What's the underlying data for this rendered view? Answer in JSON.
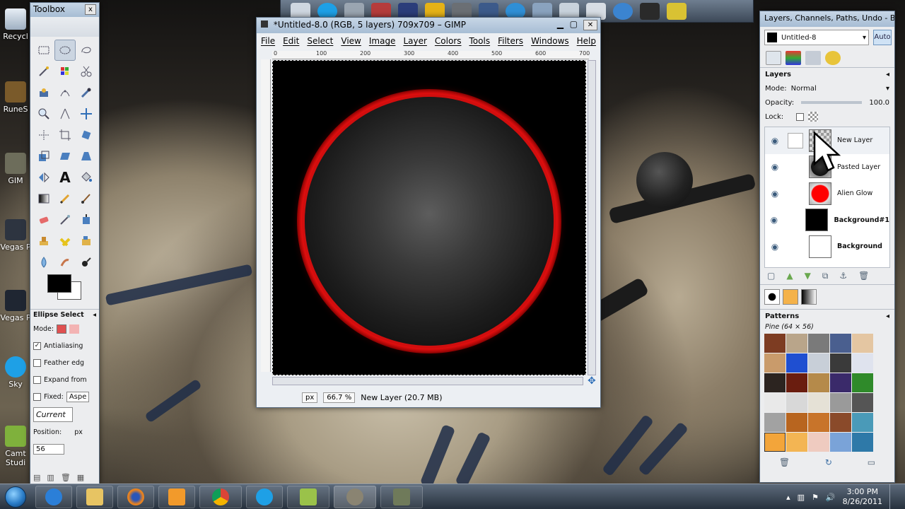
{
  "desktop": {
    "icons": [
      {
        "label": "Recycl"
      },
      {
        "label": "RuneS"
      },
      {
        "label": "GIM"
      },
      {
        "label": "Vegas P"
      },
      {
        "label": "Vegas P"
      },
      {
        "label": "Sky"
      },
      {
        "label": "Camt\nStudi"
      }
    ]
  },
  "toolbox": {
    "title": "Toolbox",
    "close": "x",
    "tool_options_title": "Ellipse Select",
    "mode_label": "Mode:",
    "antialiasing": "Antialiasing",
    "feather_edges": "Feather edg",
    "expand_from": "Expand from",
    "fixed_label": "Fixed:",
    "fixed_value": "Aspe",
    "current": "Current",
    "position_label": "Position:",
    "position_unit": "px",
    "position_value": "56"
  },
  "image_window": {
    "title": "*Untitled-8.0 (RGB, 5 layers) 709x709 – GIMP",
    "menus": [
      "File",
      "Edit",
      "Select",
      "View",
      "Image",
      "Layer",
      "Colors",
      "Tools",
      "Filters",
      "Windows",
      "Help"
    ],
    "ruler_ticks": [
      "0",
      "100",
      "200",
      "300",
      "400",
      "500",
      "600",
      "700"
    ],
    "unit": "px",
    "zoom": "66.7 %",
    "status": "New Layer (20.7 MB)"
  },
  "dock": {
    "title": "Layers, Channels, Paths, Undo - B...",
    "image_name": "Untitled-8",
    "auto": "Auto",
    "layers_title": "Layers",
    "mode_label": "Mode:",
    "mode_value": "Normal",
    "opacity_label": "Opacity:",
    "opacity_value": "100.0",
    "lock_label": "Lock:",
    "layers": [
      {
        "name": "New Layer",
        "bold": false
      },
      {
        "name": "Pasted Layer",
        "bold": false
      },
      {
        "name": "Alien Glow",
        "bold": false
      },
      {
        "name": "Background#1",
        "bold": true
      },
      {
        "name": "Background",
        "bold": true
      }
    ],
    "patterns_title": "Patterns",
    "pattern_name": "Pine (64 × 56)"
  },
  "taskbar": {
    "time": "3:00 PM",
    "date": "8/26/2011"
  },
  "colors": {
    "glow_red": "#d10e0e",
    "dock_bg": "#ecedef",
    "titlebar": "#a7bdd4"
  }
}
